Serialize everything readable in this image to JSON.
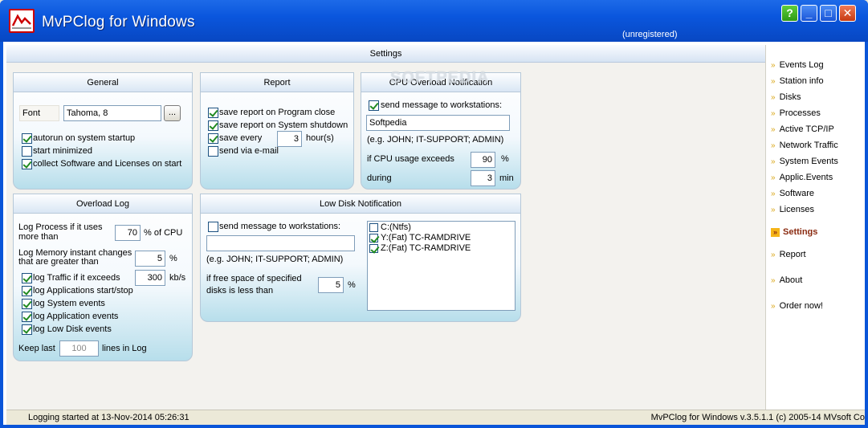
{
  "window": {
    "title": "MvPClog for Windows",
    "registration": "(unregistered)",
    "buttons": {
      "help": "?",
      "minimize": "_",
      "maximize": "□",
      "close": "✕"
    }
  },
  "main": {
    "header": "Settings",
    "watermark": "SOFTPEDIA"
  },
  "general": {
    "title": "General",
    "font_label": "Font",
    "font_value": "Tahoma, 8",
    "browse_label": "...",
    "autorun": {
      "label": "autorun on system startup",
      "checked": true
    },
    "start_minimized": {
      "label": "start minimized",
      "checked": false
    },
    "collect_software": {
      "label": "collect Software and Licenses on start",
      "checked": true
    }
  },
  "report": {
    "title": "Report",
    "on_close": {
      "label": "save report on Program close",
      "checked": true
    },
    "on_shutdown": {
      "label": "save report on System shutdown",
      "checked": true
    },
    "save_every": {
      "label": "save every",
      "value": "3",
      "unit": "hour(s)",
      "checked": true
    },
    "via_email": {
      "label": "send via e-mail",
      "checked": false
    }
  },
  "cpu_overload": {
    "title": "CPU Overload Notification",
    "send_message": {
      "label": "send message to workstations:",
      "checked": true
    },
    "workstations": "Softpedia",
    "example": "(e.g. JOHN; IT-SUPPORT; ADMIN)",
    "exceeds_label": "if CPU usage exceeds",
    "exceeds_value": "90",
    "exceeds_unit": "%",
    "during_label": "during",
    "during_value": "3",
    "during_unit": "min"
  },
  "overload_log": {
    "title": "Overload Log",
    "process_label_1": "Log Process if it uses",
    "process_label_2": "more than",
    "process_value": "70",
    "process_unit": "% of CPU",
    "memory_label_1": "Log Memory instant changes",
    "memory_label_2": "that are greater than",
    "memory_value": "5",
    "memory_unit": "%",
    "traffic": {
      "label": "log Traffic if it exceeds",
      "value": "300",
      "unit": "kb/s",
      "checked": true
    },
    "apps": {
      "label": "log Applications start/stop",
      "checked": true
    },
    "system_events": {
      "label": "log System events",
      "checked": true
    },
    "app_events": {
      "label": "log Application events",
      "checked": true
    },
    "low_disk": {
      "label": "log Low Disk events",
      "checked": true
    },
    "keep_last_label": "Keep last",
    "keep_last_value": "100",
    "keep_last_unit": "lines in Log"
  },
  "low_disk": {
    "title": "Low Disk Notification",
    "send_message": {
      "label": "send message to workstations:",
      "checked": false
    },
    "workstations": "",
    "example": "(e.g. JOHN; IT-SUPPORT; ADMIN)",
    "free_space_label_1": "if free space of specified",
    "free_space_label_2": "disks is less than",
    "free_space_value": "5",
    "free_space_unit": "%",
    "disks": [
      {
        "label": "C:(Ntfs)",
        "checked": false
      },
      {
        "label": "Y:(Fat) TC-RAMDRIVE",
        "checked": true
      },
      {
        "label": "Z:(Fat) TC-RAMDRIVE",
        "checked": true
      }
    ]
  },
  "sidebar": {
    "items": [
      "Events Log",
      "Station info",
      "Disks",
      "Processes",
      "Active TCP/IP",
      "Network Traffic",
      "System Events",
      "Applic.Events",
      "Software",
      "Licenses",
      "Settings",
      "Report",
      "About",
      "Order now!"
    ],
    "active": "Settings",
    "chevron": "»"
  },
  "status": {
    "left": "Logging started at 13-Nov-2014 05:26:31",
    "right": "MvPClog for Windows v.3.5.1.1 (c) 2005-14 MVsoft Co"
  }
}
